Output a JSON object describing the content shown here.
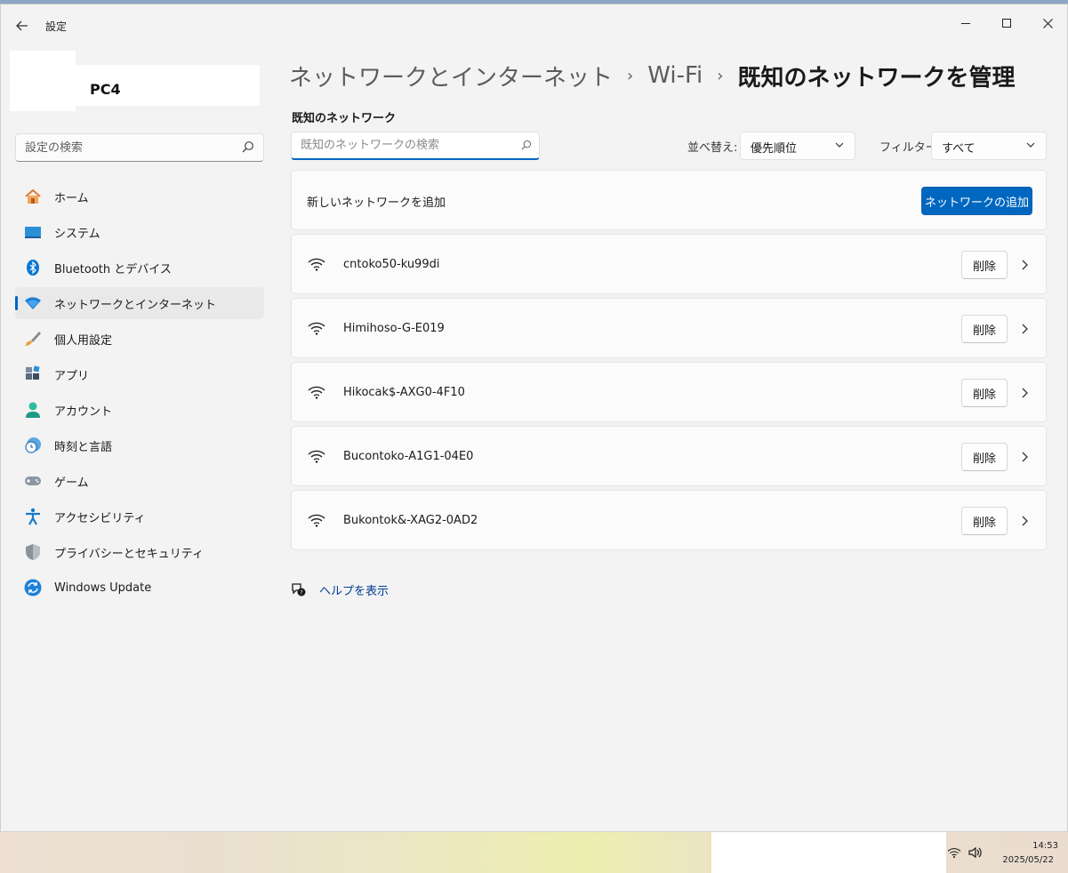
{
  "window": {
    "title": "設定",
    "back_icon": "arrow-left-icon"
  },
  "profile": {
    "pc_name": "PC4"
  },
  "sidebar": {
    "search_placeholder": "設定の検索",
    "items": [
      {
        "label": "ホーム",
        "icon": "home-icon",
        "active": false
      },
      {
        "label": "システム",
        "icon": "system-icon",
        "active": false
      },
      {
        "label": "Bluetooth とデバイス",
        "icon": "bluetooth-icon",
        "active": false
      },
      {
        "label": "ネットワークとインターネット",
        "icon": "network-icon",
        "active": true
      },
      {
        "label": "個人用設定",
        "icon": "brush-icon",
        "active": false
      },
      {
        "label": "アプリ",
        "icon": "apps-icon",
        "active": false
      },
      {
        "label": "アカウント",
        "icon": "account-icon",
        "active": false
      },
      {
        "label": "時刻と言語",
        "icon": "time-language-icon",
        "active": false
      },
      {
        "label": "ゲーム",
        "icon": "gamepad-icon",
        "active": false
      },
      {
        "label": "アクセシビリティ",
        "icon": "accessibility-icon",
        "active": false
      },
      {
        "label": "プライバシーとセキュリティ",
        "icon": "shield-icon",
        "active": false
      },
      {
        "label": "Windows Update",
        "icon": "update-icon",
        "active": false
      }
    ]
  },
  "breadcrumb": {
    "items": [
      "ネットワークとインターネット",
      "Wi-Fi"
    ],
    "current": "既知のネットワークを管理"
  },
  "main": {
    "section_title": "既知のネットワーク",
    "search_placeholder": "既知のネットワークの検索",
    "sort_label": "並べ替え:",
    "sort_value": "優先順位",
    "filter_label": "フィルター:",
    "filter_value": "すべて",
    "add_label": "新しいネットワークを追加",
    "add_button": "ネットワークの追加",
    "networks": [
      {
        "name": "cntoko50-ku99di",
        "delete_label": "削除"
      },
      {
        "name": "Himihoso-G-E019",
        "delete_label": "削除"
      },
      {
        "name": "Hikocak$-AXG0-4F10",
        "delete_label": "削除"
      },
      {
        "name": "Bucontoko-A1G1-04E0",
        "delete_label": "削除"
      },
      {
        "name": "Bukontok&-XAG2-0AD2",
        "delete_label": "削除"
      }
    ],
    "help_text": "ヘルプを表示"
  },
  "taskbar": {
    "time": "14:53",
    "date": "2025/05/22"
  },
  "colors": {
    "accent": "#0067c0",
    "link": "#003e92"
  }
}
